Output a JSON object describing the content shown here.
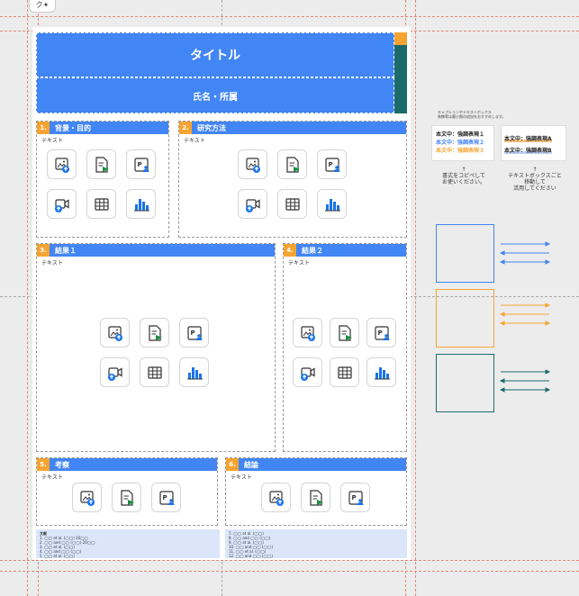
{
  "canvas": {
    "tab_icon_label": "ク✦"
  },
  "poster": {
    "title": "タイトル",
    "author": "氏名・所属",
    "sections": [
      {
        "num": "1.",
        "title": "背景・目的",
        "body": "テキスト"
      },
      {
        "num": "2.",
        "title": "研究方法",
        "body": "テキスト"
      },
      {
        "num": "3.",
        "title": "結果１",
        "body": "テキスト"
      },
      {
        "num": "4.",
        "title": "結果２",
        "body": "テキスト"
      },
      {
        "num": "5.",
        "title": "考察",
        "body": "テキスト"
      },
      {
        "num": "6.",
        "title": "結論",
        "body": "テキスト"
      }
    ],
    "references_left": {
      "heading": "文献",
      "items": [
        "1. ◯◯ et al. (◯◯) 20◯◯",
        "2. ◯◯ and ◯◯ (◯◯) 20◯◯",
        "3. ◯◯ et al. (◯◯)",
        "4. ◯◯ and ◯◯ (◯◯)",
        "5. ◯◯ et al. (◯◯)",
        "6. ◯◯ and ◯◯ (◯◯)"
      ]
    },
    "references_right": {
      "items": [
        "7. ◯◯ et al. (◯◯)",
        "8. ◯◯ and ◯◯ (◯◯)",
        "9. ◯◯ et al. (◯◯)",
        "10. ◯◯ and ◯◯ (◯◯)",
        "11. ◯◯ et al. (◯◯)",
        "12. ◯◯ and ◯◯ (◯◯)"
      ]
    }
  },
  "side_panel": {
    "caption_line1": "キャプションやテキストボックス",
    "caption_line2": "装飾等は最小限の追加をおすすめします。",
    "card1": {
      "line1": "本文中：強調表現１",
      "line2": "本文中：強調表現２",
      "line3": "本文中：強調表現３"
    },
    "card2": {
      "line1": "本文中：強調表現A",
      "line2": "本文中：強調表現B"
    },
    "note1": "書式をコピペして\nお使いください。",
    "note2": "テキストボックスごと\n移動して\n活用してください"
  },
  "colors": {
    "blue": "#4285f4",
    "orange": "#f6a431",
    "teal": "#1b6b6b",
    "light_blue_bg": "#dbe6fb"
  },
  "icons": [
    "image-upload-icon",
    "slides-insert-icon",
    "profile-doc-icon",
    "video-upload-icon",
    "table-icon",
    "bar-chart-icon"
  ]
}
